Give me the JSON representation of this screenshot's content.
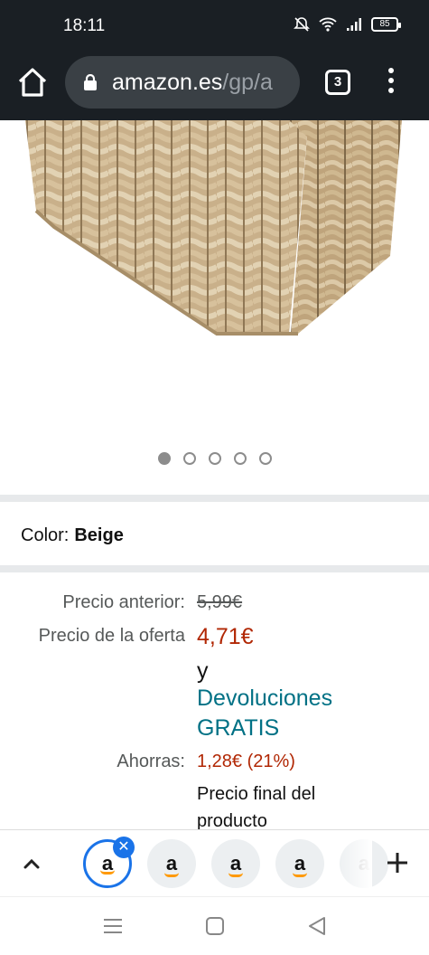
{
  "status_bar": {
    "time": "18:11",
    "battery": "85"
  },
  "browser": {
    "url_domain": "amazon.es",
    "url_path": "/gp/a",
    "tab_count": "3"
  },
  "carousel": {
    "count": 5,
    "active_index": 0
  },
  "product": {
    "color_label": "Color:",
    "color_value": "Beige",
    "prices": {
      "previous_label": "Precio anterior:",
      "previous_value": "5,99€",
      "offer_label": "Precio de la oferta",
      "offer_value": "4,71€",
      "and": "y",
      "returns_line1": "Devoluciones",
      "returns_line2": "GRATIS",
      "savings_label": "Ahorras:",
      "savings_value": "1,28€ (21%)",
      "final_line1": "Precio final del",
      "final_line2": "producto"
    }
  },
  "tabstrip": {
    "favicon_letter": "a",
    "close_symbol": "✕"
  },
  "colors": {
    "price_red": "#b12704",
    "link_teal": "#007185",
    "selected_tab": "#1a73e8",
    "toolbar": "#1a1f24"
  }
}
